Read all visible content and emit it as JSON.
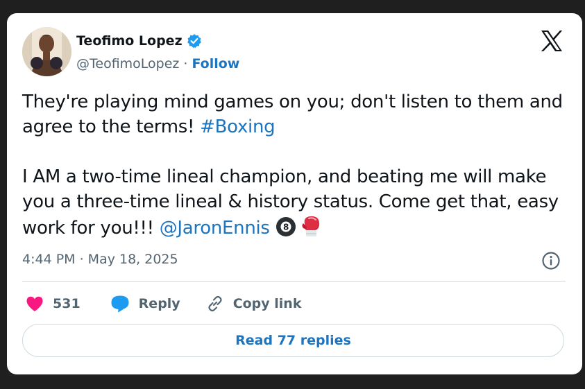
{
  "author": {
    "name": "Teofimo Lopez",
    "handle": "@TeofimoLopez",
    "separator": "·",
    "follow_label": "Follow",
    "verified": true
  },
  "tweet": {
    "paragraph1_text": "They're playing mind games on you; don't listen to them and agree to the terms! ",
    "paragraph1_hashtag": "#Boxing",
    "paragraph2_text": "I AM a two-time lineal champion, and beating me will make you a three-time lineal & history status. Come get that, easy work for you!!! ",
    "paragraph2_mention": "@JaronEnnis",
    "emojis": [
      "8-ball",
      "boxing-glove"
    ],
    "timestamp": "4:44 PM · May 18, 2025"
  },
  "actions": {
    "like_count": "531",
    "reply_label": "Reply",
    "copy_link_label": "Copy link"
  },
  "footer": {
    "read_replies_label": "Read 77 replies"
  },
  "colors": {
    "link": "#1d74bf",
    "verified": "#1d9bf0",
    "heart": "#f91880",
    "reply_bubble": "#1d9bf0",
    "text": "#0f1419",
    "muted": "#536471"
  },
  "icons": [
    "verified-badge-icon",
    "x-logo-icon",
    "info-icon",
    "heart-icon",
    "reply-bubble-icon",
    "link-icon",
    "eight-ball-emoji",
    "boxing-glove-emoji"
  ]
}
